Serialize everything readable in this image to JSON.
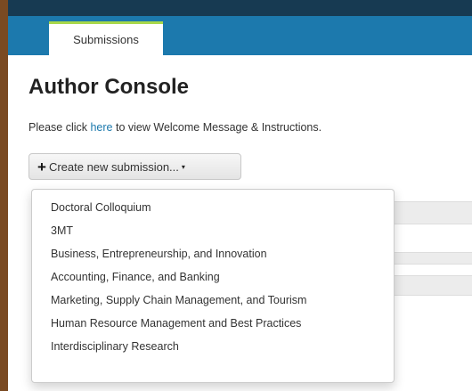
{
  "nav": {
    "tabs": [
      {
        "label": "Submissions",
        "active": true
      }
    ]
  },
  "main": {
    "title": "Author Console",
    "instructions": {
      "before": "Please click ",
      "link": "here",
      "after": " to view Welcome Message & Instructions."
    },
    "create_button": {
      "icon": "plus-icon",
      "label": "Create new submission...",
      "caret": "▾"
    },
    "dropdown": {
      "items": [
        "Doctoral Colloquium",
        "3MT",
        "Business, Entrepreneurship, and Innovation",
        "Accounting, Finance, and Banking",
        "Marketing, Supply Chain Management, and Tourism",
        "Human Resource Management and Best Practices",
        "Interdisciplinary Research"
      ]
    }
  },
  "colors": {
    "header_dark": "#173a52",
    "header_blue": "#1c79ad",
    "tab_accent": "#a8d84a",
    "link": "#1c79ad",
    "border_frame": "#7a4a22"
  }
}
